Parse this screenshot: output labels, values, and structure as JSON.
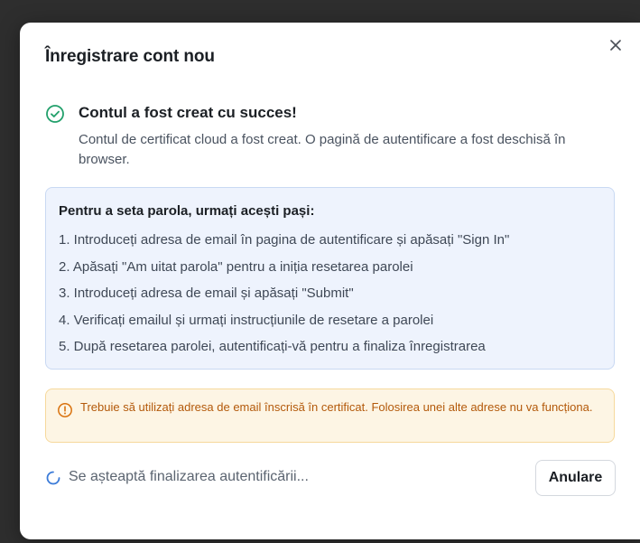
{
  "dialog": {
    "title": "Înregistrare cont nou",
    "close_icon": "close-icon"
  },
  "success": {
    "icon": "check-circle-icon",
    "color": "#22a06b",
    "heading": "Contul a fost creat cu succes!",
    "description": "Contul de certificat cloud a fost creat. O pagină de autentificare a fost deschisă în browser."
  },
  "steps": {
    "title": "Pentru a seta parola, urmați acești pași:",
    "items": [
      "1. Introduceți adresa de email în pagina de autentificare și apăsați \"Sign In\"",
      "2. Apăsați \"Am uitat parola\" pentru a iniția resetarea parolei",
      "3. Introduceți adresa de email și apăsați \"Submit\"",
      "4. Verificați emailul și urmați instrucțiunile de resetare a parolei",
      "5. După resetarea parolei, autentificați-vă pentru a finaliza înregistrarea"
    ]
  },
  "warning": {
    "icon": "warning-circle-icon",
    "color": "#d9720e",
    "text": "Trebuie să utilizați adresa de email înscrisă în certificat. Folosirea unei alte adrese nu va funcționa."
  },
  "footer": {
    "spinner_icon": "spinner-icon",
    "status": "Se așteaptă finalizarea autentificării...",
    "cancel_label": "Anulare"
  }
}
